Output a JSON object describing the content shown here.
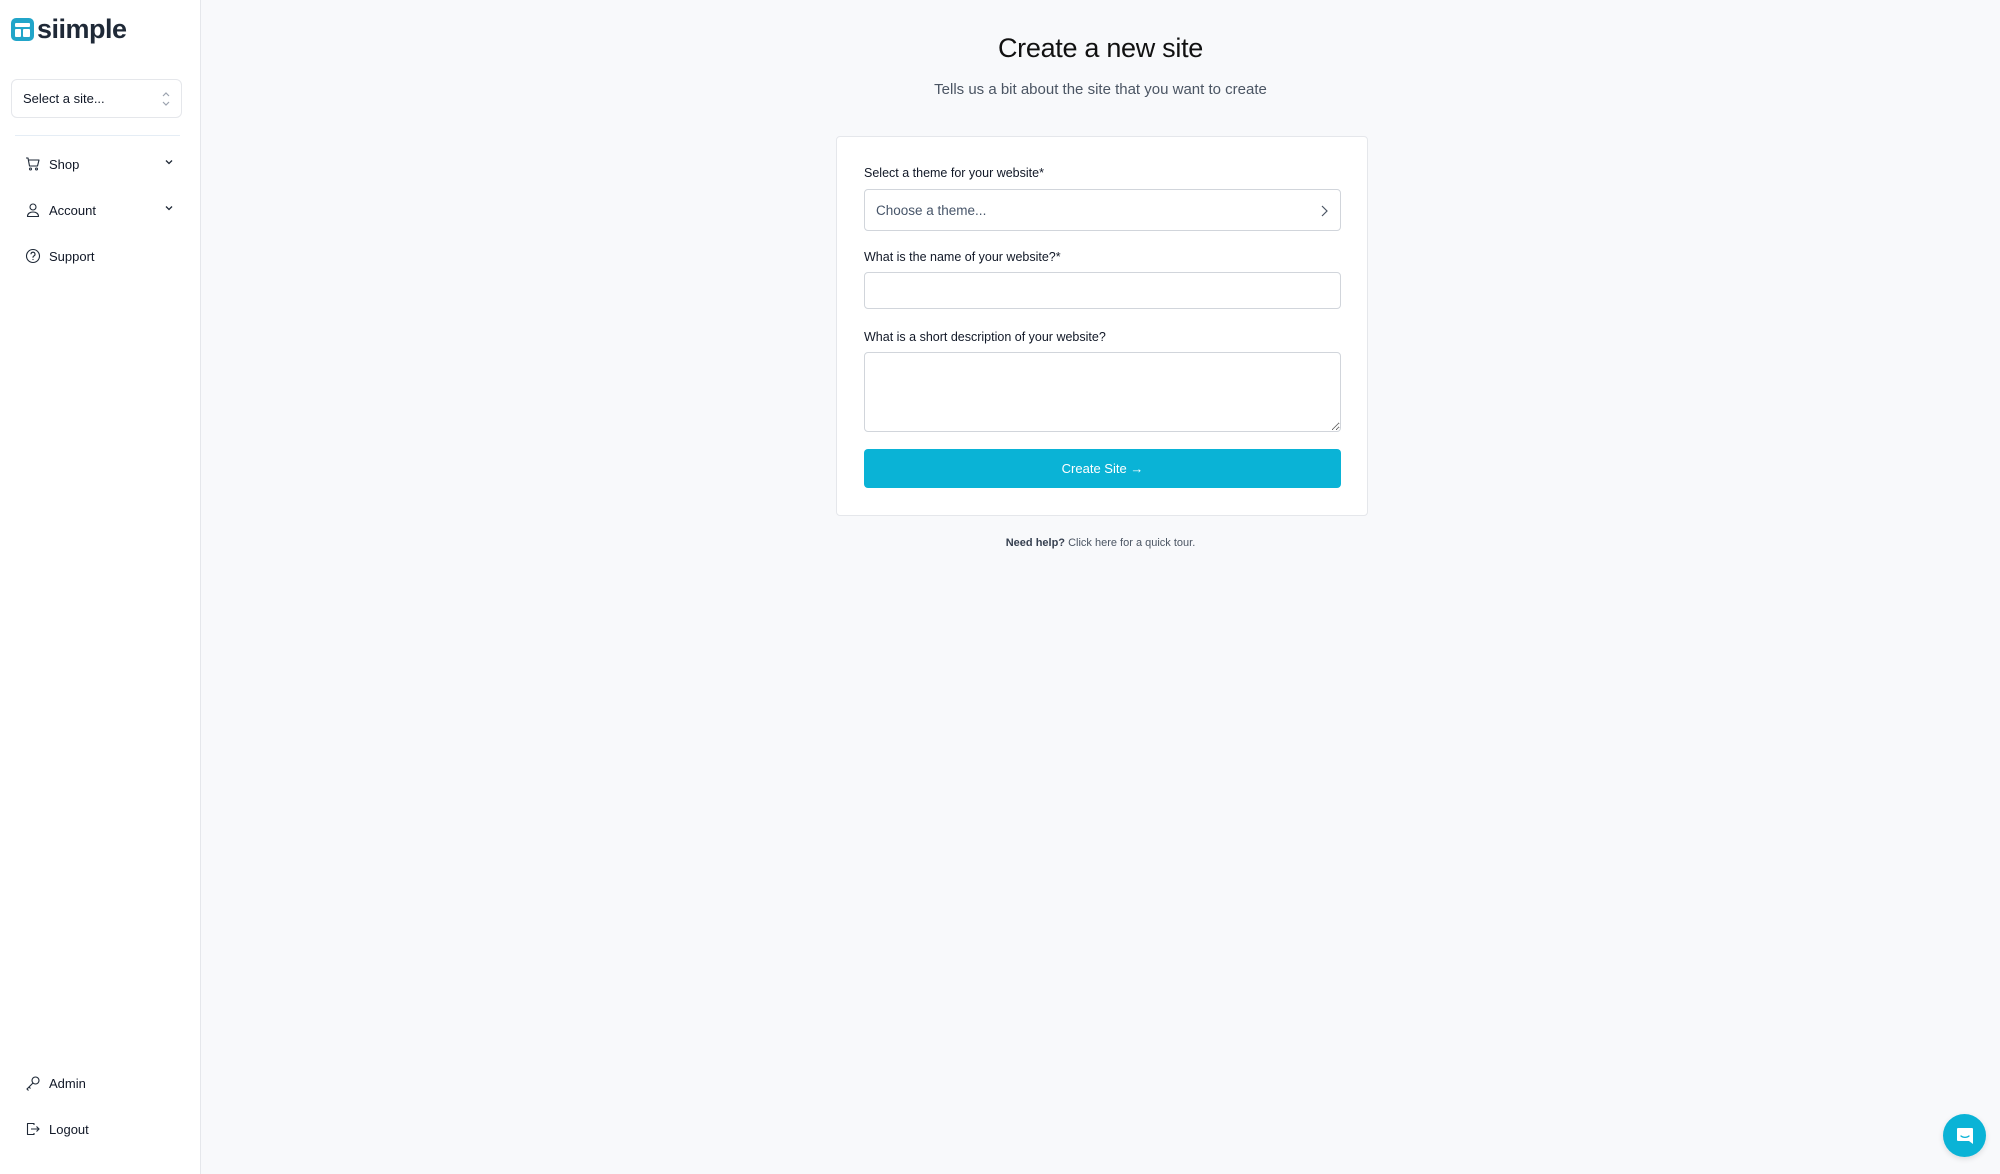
{
  "app": {
    "brand_name": "siimple",
    "brand_color": "#22a5c9",
    "accent_color": "#0ab3d6"
  },
  "sidebar": {
    "site_select": {
      "placeholder": "Select a site...",
      "icon": "chevron-up-down-icon"
    },
    "nav_items": [
      {
        "label": "Shop",
        "icon": "cart-icon",
        "expandable": true
      },
      {
        "label": "Account",
        "icon": "user-icon",
        "expandable": true
      },
      {
        "label": "Support",
        "icon": "help-circle-icon",
        "expandable": false
      }
    ],
    "bottom_items": [
      {
        "label": "Admin",
        "icon": "key-icon"
      },
      {
        "label": "Logout",
        "icon": "logout-icon"
      }
    ]
  },
  "main": {
    "title": "Create a new site",
    "subtitle": "Tells us a bit about the site that you want to create",
    "form": {
      "theme": {
        "label": "Select a theme for your website*",
        "placeholder": "Choose a theme...",
        "value": ""
      },
      "name": {
        "label": "What is the name of your website?*",
        "value": "",
        "placeholder": ""
      },
      "description": {
        "label": "What is a short description of your website?",
        "value": "",
        "placeholder": ""
      },
      "submit_label": "Create Site →"
    },
    "help": {
      "bold": "Need help?",
      "link": "Click here for a quick tour."
    }
  },
  "chat_widget": {
    "icon": "chat-icon"
  }
}
